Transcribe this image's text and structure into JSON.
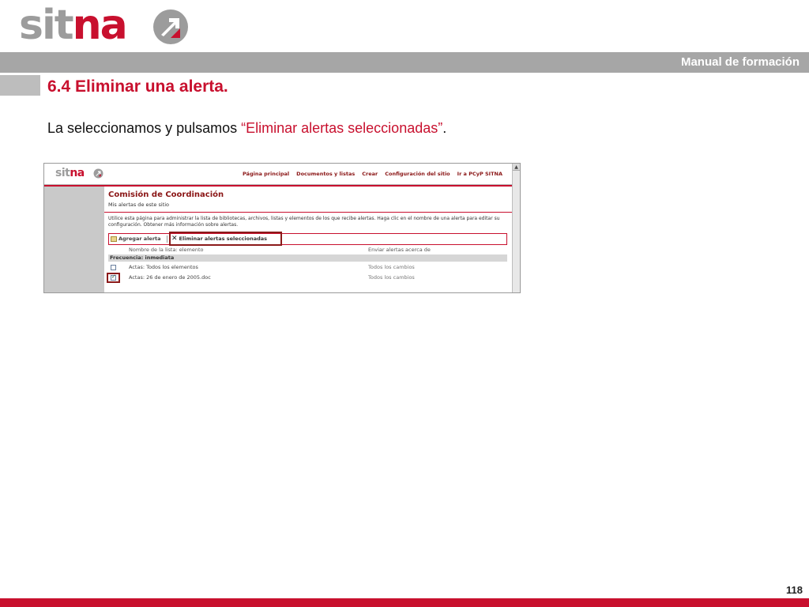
{
  "slide": {
    "logo": {
      "text_a": "sit",
      "text_b": "na"
    },
    "header_label": "Manual de formación",
    "title": "6.4 Eliminar una alerta.",
    "instruction": {
      "before": "La seleccionamos y pulsamos ",
      "highlight": "“Eliminar alertas seleccionadas”",
      "after": "."
    },
    "page_number": "118",
    "colors": {
      "accent": "#c8102e",
      "band": "#a6a6a6"
    }
  },
  "screenshot": {
    "logo": {
      "text_a": "sit",
      "text_b": "na"
    },
    "nav": [
      "Página principal",
      "Documentos y listas",
      "Crear",
      "Configuración del sitio",
      "Ir a PCyP SITNA"
    ],
    "site_title": "Comisión de Coordinación",
    "site_subtitle": "Mis alertas de este sitio",
    "description": "Utilice esta página para administrar la lista de bibliotecas, archivos, listas y elementos de los que recibe alertas. Haga clic en el nombre de una alerta para editar su configuración. Obtener más información sobre alertas.",
    "toolbar": {
      "add_label": "Agregar alerta",
      "delete_label": "Eliminar alertas seleccionadas"
    },
    "columns": {
      "name": "Nombre de la lista: elemento",
      "send": "Enviar alertas acerca de"
    },
    "group": "Frecuencia: inmediata",
    "rows": [
      {
        "name": "Actas: Todos los elementos",
        "send": "Todos los cambios",
        "checked": false
      },
      {
        "name": "Actas: 26 de enero de 2005.doc",
        "send": "Todos los cambios",
        "checked": true
      }
    ]
  }
}
